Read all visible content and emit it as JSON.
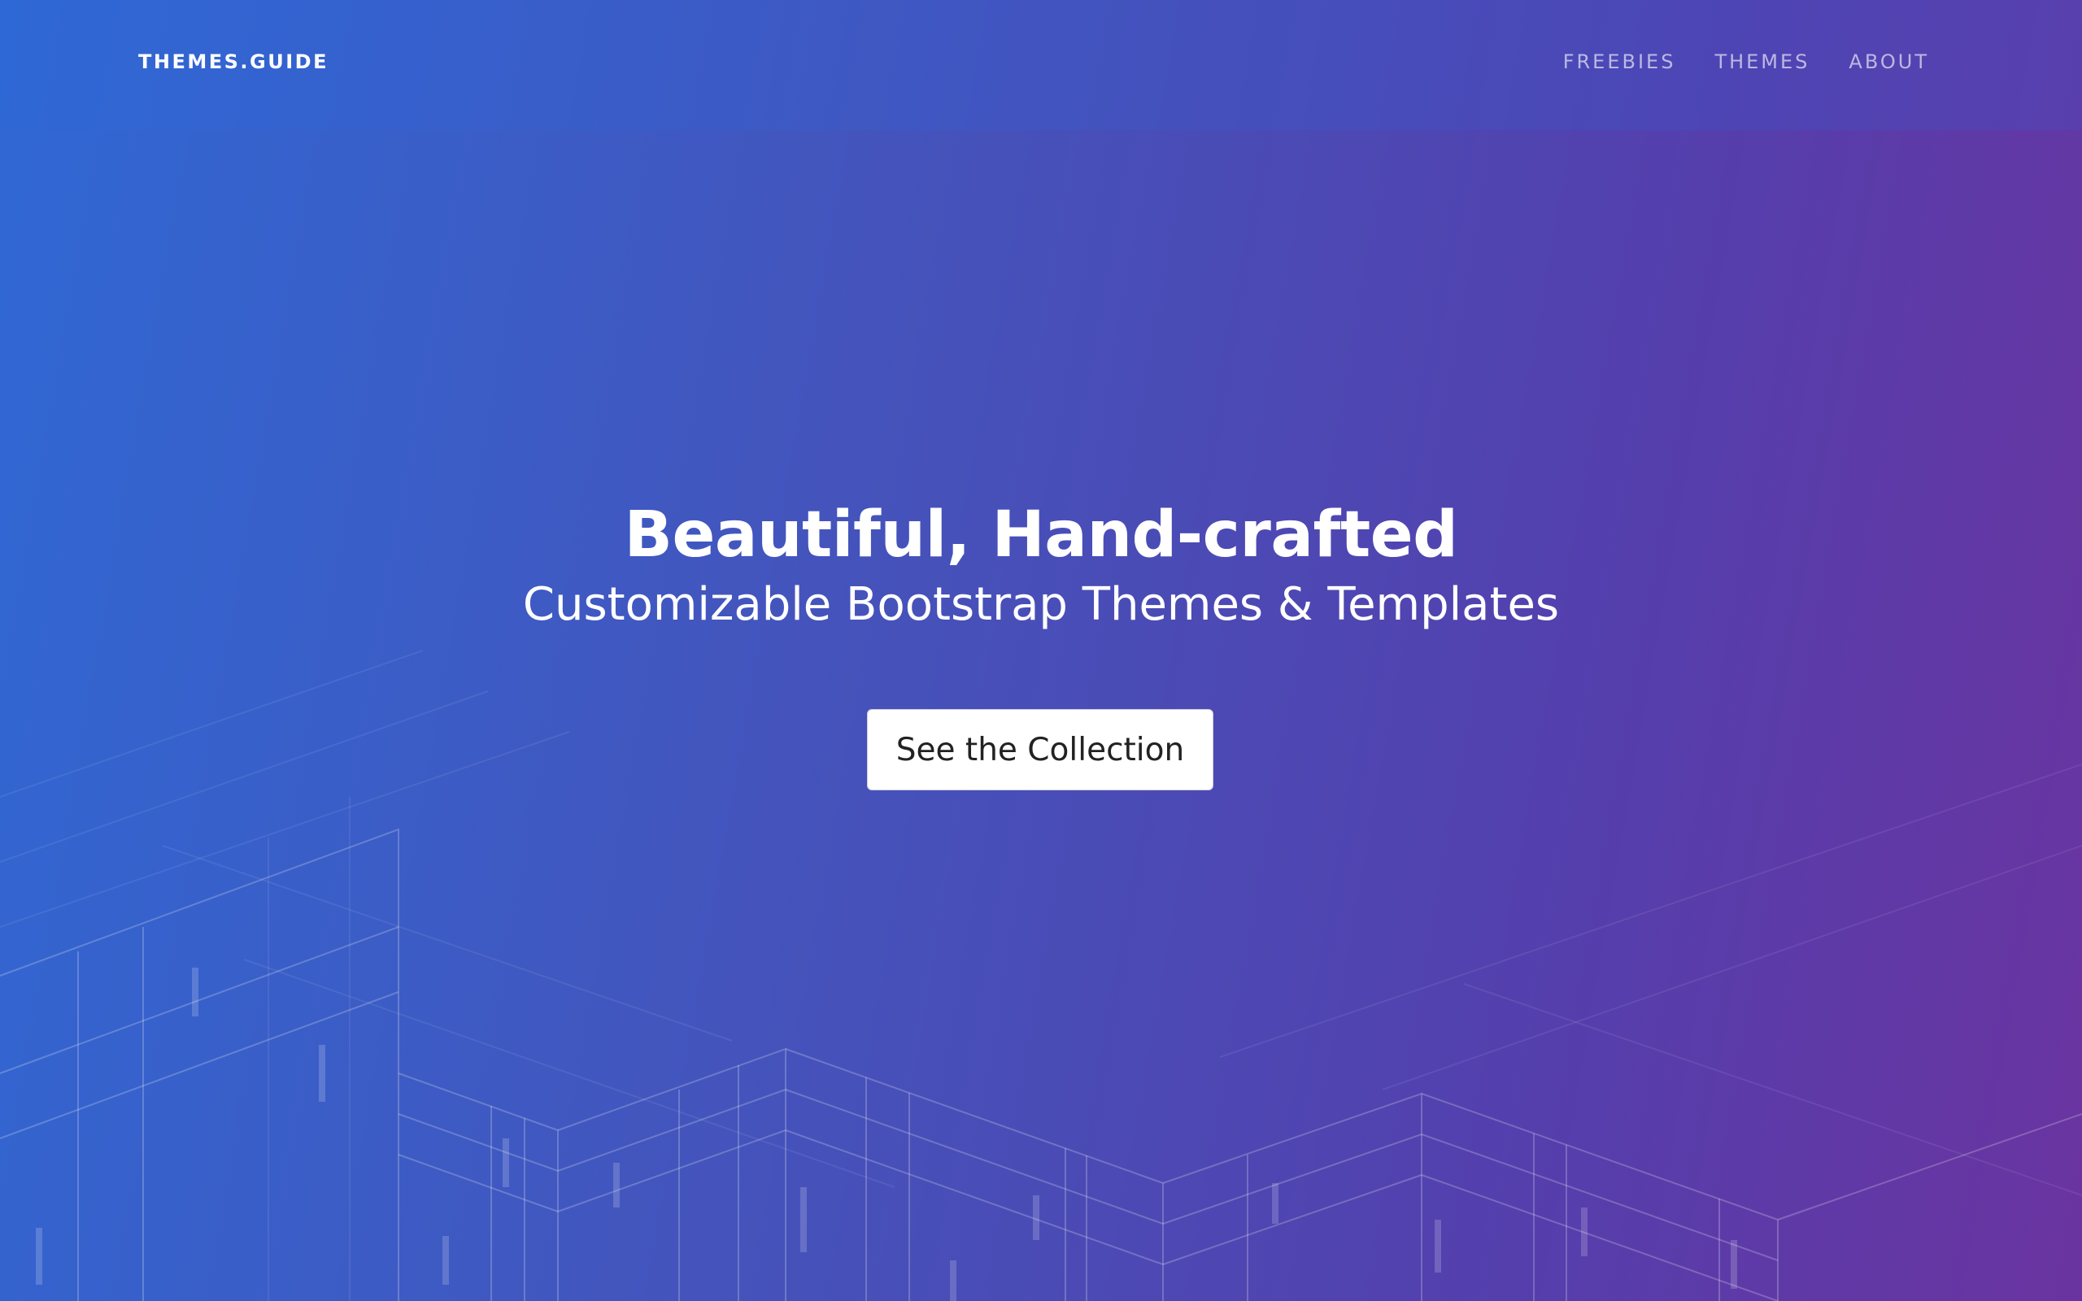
{
  "navbar": {
    "brand": "THEMES.GUIDE",
    "links": [
      {
        "label": "FREEBIES"
      },
      {
        "label": "THEMES"
      },
      {
        "label": "ABOUT"
      }
    ]
  },
  "hero": {
    "title": "Beautiful, Hand-crafted",
    "subtitle": "Customizable Bootstrap Themes & Templates",
    "cta_label": "See the Collection"
  },
  "colors": {
    "gradient_start": "#3068d4",
    "gradient_mid": "#4454bc",
    "gradient_end": "#6a34a0",
    "button_bg": "#ffffff",
    "button_text": "#222222"
  },
  "decor": {
    "background_art": "isometric-wireframe-buildings"
  }
}
